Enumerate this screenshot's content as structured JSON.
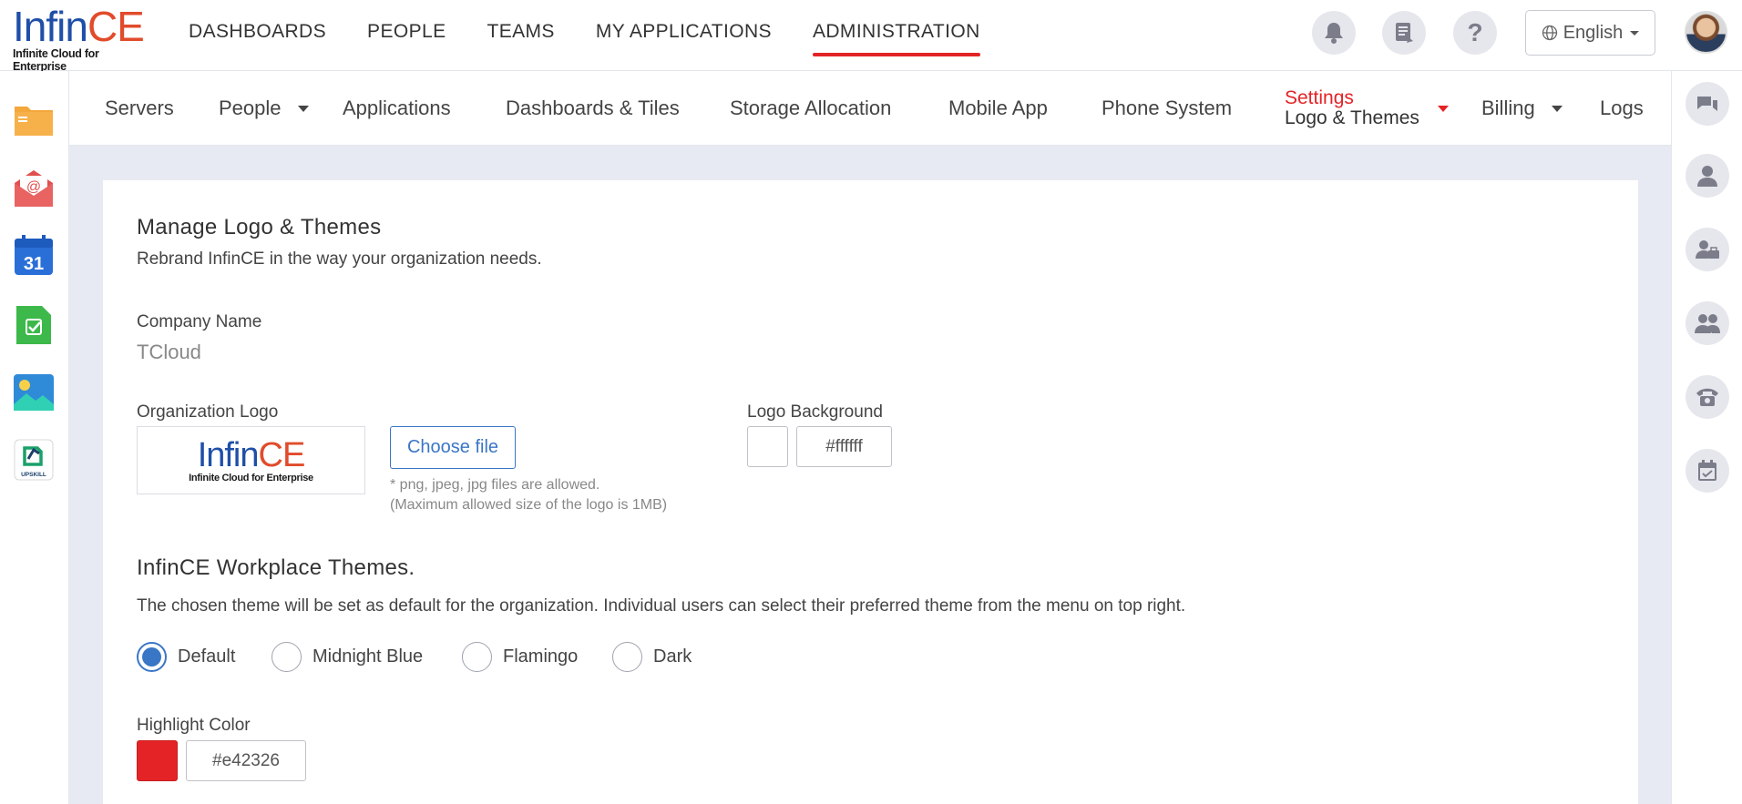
{
  "brand": {
    "logo_word_a": "Infin",
    "logo_word_b": "CE",
    "logo_tagline": "Infinite Cloud for Enterprise",
    "accent": "#e42326",
    "primary": "#3a76c6"
  },
  "main_nav": [
    {
      "label": "DASHBOARDS",
      "active": false
    },
    {
      "label": "PEOPLE",
      "active": false
    },
    {
      "label": "TEAMS",
      "active": false
    },
    {
      "label": "MY APPLICATIONS",
      "active": false
    },
    {
      "label": "ADMINISTRATION",
      "active": true
    }
  ],
  "topbar": {
    "language": "English",
    "icons": [
      "bell-icon",
      "notes-icon",
      "help-icon"
    ],
    "help_glyph": "?"
  },
  "left_apps": [
    "files-app-icon",
    "mail-app-icon",
    "calendar-app-icon",
    "tasks-app-icon",
    "photos-app-icon",
    "upskill-app-icon"
  ],
  "calendar_day": "31",
  "upskill_label": "UPSKILL",
  "right_rail": [
    "chat-icon",
    "user-icon",
    "user-briefcase-icon",
    "users-icon",
    "phone-icon",
    "calendar-check-icon"
  ],
  "sub_nav": {
    "servers": "Servers",
    "people": "People",
    "applications": "Applications",
    "dashboards": "Dashboards & Tiles",
    "storage": "Storage Allocation",
    "mobile": "Mobile App",
    "phone": "Phone System",
    "settings": "Settings",
    "settings_sub": "Logo & Themes",
    "billing": "Billing",
    "logs": "Logs"
  },
  "page": {
    "title": "Manage Logo & Themes",
    "subtitle": "Rebrand InfinCE in the way your organization needs.",
    "company_label": "Company Name",
    "company_value": "TCloud",
    "org_logo_label": "Organization Logo",
    "choose_file": "Choose file",
    "hint_1": "* png, jpeg, jpg files are allowed.",
    "hint_2": "(Maximum allowed size of the logo is 1MB)",
    "logo_bg_label": "Logo Background",
    "logo_bg_value": "#ffffff",
    "themes_title": "InfinCE Workplace Themes.",
    "themes_desc": "The chosen theme will be set as default for the organization. Individual users can select their preferred theme from the menu on top right.",
    "themes": [
      {
        "label": "Default",
        "checked": true
      },
      {
        "label": "Midnight Blue",
        "checked": false
      },
      {
        "label": "Flamingo",
        "checked": false
      },
      {
        "label": "Dark",
        "checked": false
      }
    ],
    "highlight_label": "Highlight Color",
    "highlight_value": "#e42326"
  }
}
